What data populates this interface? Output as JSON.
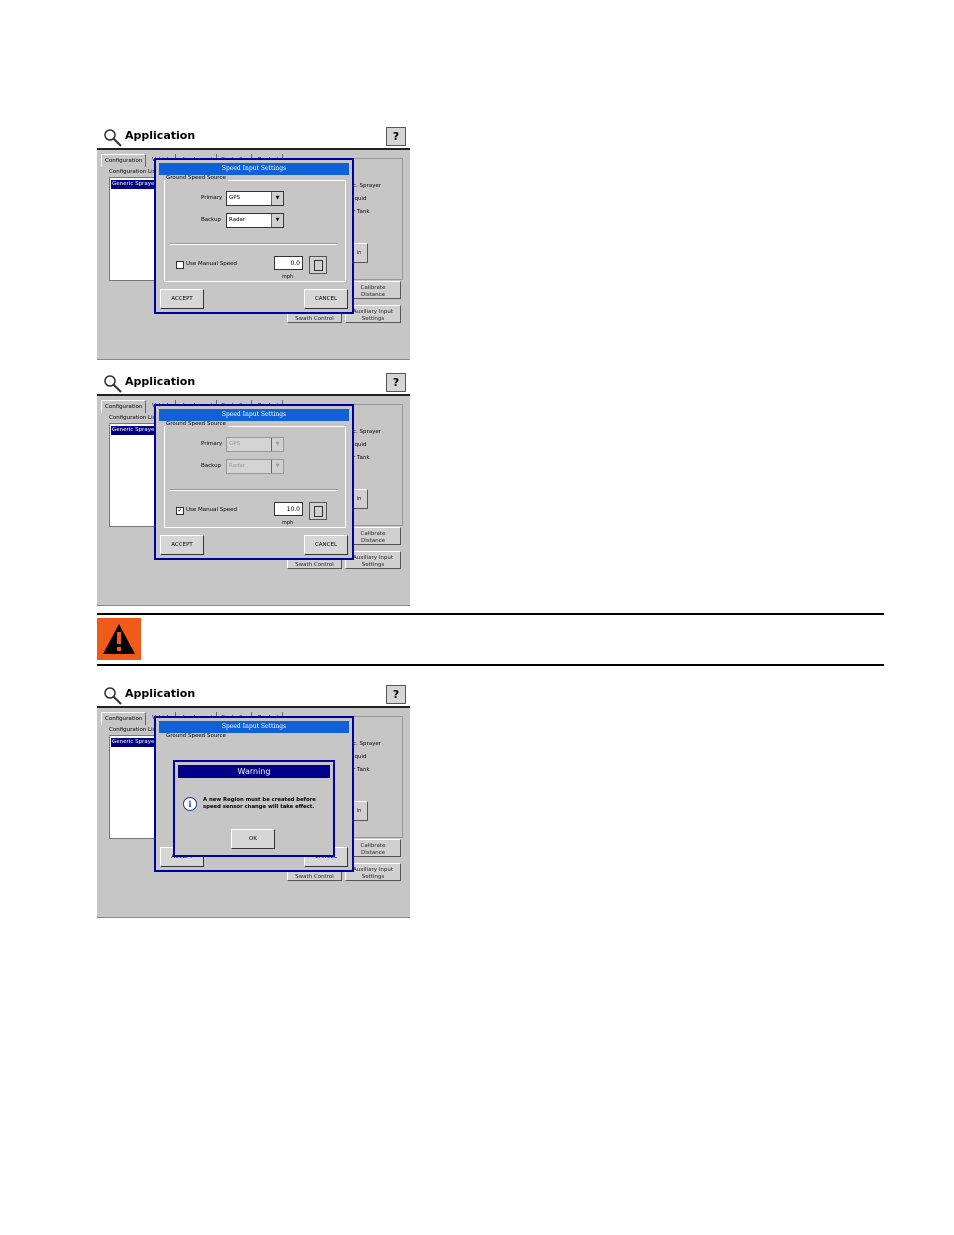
{
  "screens": [
    {
      "app_title": "Application",
      "help_label": "?",
      "tabs": [
        "Configuration",
        "Vehicle",
        "Implement",
        "Controller",
        "Product"
      ],
      "config_label": "Configuration List",
      "config_item": "Generic Sprayer",
      "right_texts": [
        "c. Sprayer",
        "iquid",
        "r Tank"
      ],
      "bg_buttons": {
        "calibrate": "Calibrate\nDistance",
        "auto_swath": "Automatic\nSwath Control",
        "aux_input": "Auxiliary Input\nSettings",
        "small": "in"
      },
      "dialog": {
        "title": "Speed Input Settings",
        "group_label": "Ground Speed Source",
        "primary_label": "Primary",
        "primary_value": "GPS",
        "backup_label": "Backup",
        "backup_value": "Radar",
        "manual_label": "Use Manual Speed",
        "manual_checked": false,
        "manual_value": "0.0",
        "unit": "mph",
        "accept": "ACCEPT",
        "cancel": "CANCEL"
      }
    },
    {
      "app_title": "Application",
      "help_label": "?",
      "tabs": [
        "Configuration",
        "Vehicle",
        "Implement",
        "Controller",
        "Product"
      ],
      "config_label": "Configuration List",
      "config_item": "Generic Sprayer",
      "right_texts": [
        "c. Sprayer",
        "iquid",
        "r Tank"
      ],
      "bg_buttons": {
        "calibrate": "Calibrate\nDistance",
        "auto_swath": "Automatic\nSwath Control",
        "aux_input": "Auxiliary Input\nSettings",
        "small": "in"
      },
      "dialog": {
        "title": "Speed Input Settings",
        "group_label": "Ground Speed Source",
        "primary_label": "Primary",
        "primary_value": "GPS",
        "backup_label": "Backup",
        "backup_value": "Radar",
        "manual_label": "Use Manual Speed",
        "manual_checked": true,
        "manual_value": "10.0",
        "unit": "mph",
        "accept": "ACCEPT",
        "cancel": "CANCEL"
      }
    },
    {
      "app_title": "Application",
      "help_label": "?",
      "tabs": [
        "Configuration",
        "Vehicle",
        "Implement",
        "Controller",
        "Product"
      ],
      "config_label": "Configuration List",
      "config_item": "Generic Sprayer",
      "right_texts": [
        "c. Sprayer",
        "iquid",
        "r Tank"
      ],
      "bg_buttons": {
        "calibrate": "Calibrate\nDistance",
        "auto_swath": "Automatic\nSwath Control",
        "aux_input": "Auxiliary Input\nSettings",
        "small": "in"
      },
      "dialog": {
        "title": "Speed Input Settings",
        "group_label": "Ground Speed Source",
        "accept": "ACCEPT",
        "cancel": "CANCEL"
      },
      "warning": {
        "title": "Warning",
        "message": "A new Region must be created before speed sensor change will take effect.",
        "ok": "OK"
      }
    }
  ],
  "colors": {
    "dialog_border": "#0000a0",
    "title_bar": "#1060d8",
    "warning_badge": "#f05a1a"
  }
}
